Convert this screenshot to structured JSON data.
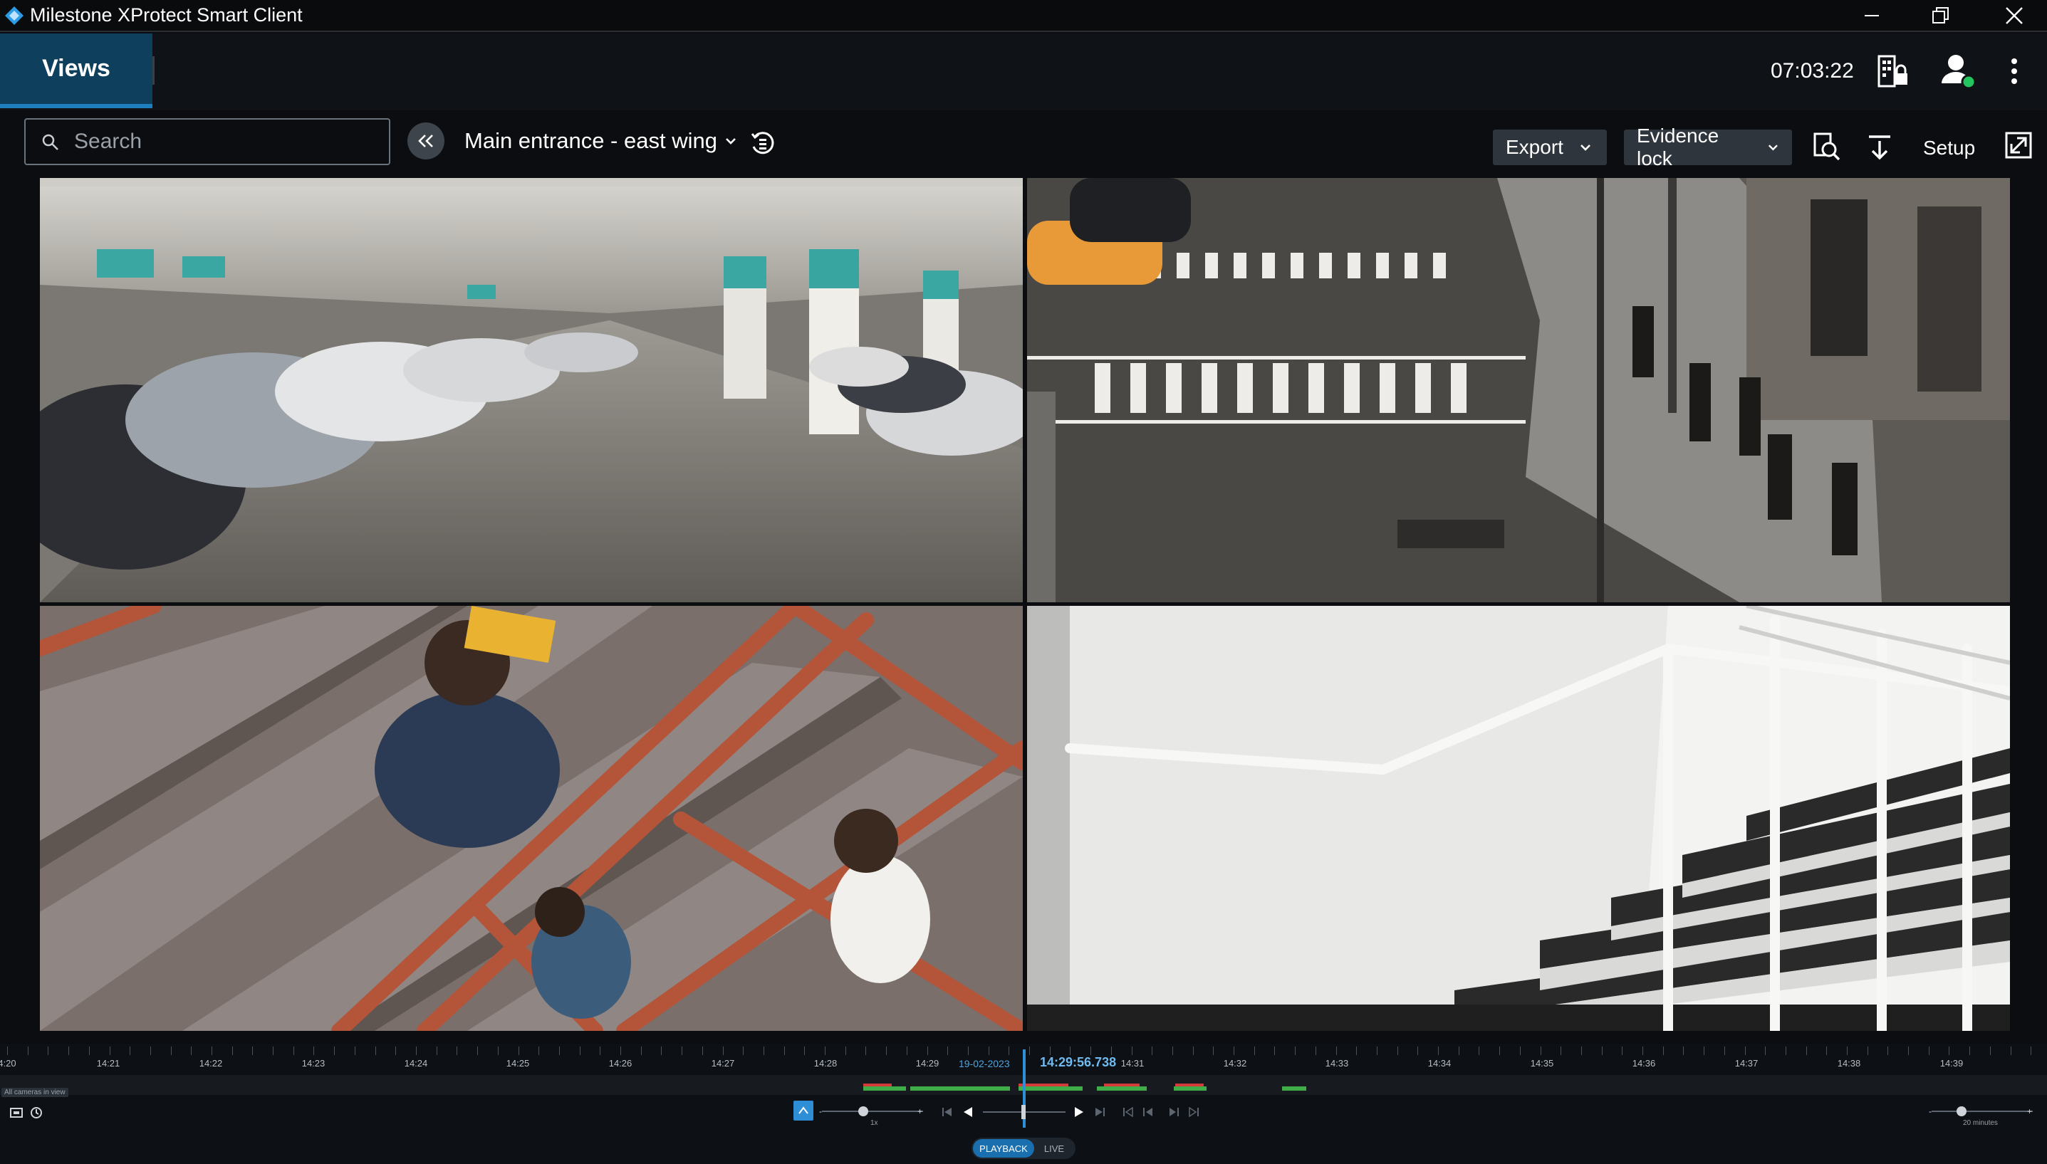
{
  "window": {
    "title": "Milestone XProtect Smart Client",
    "controls": [
      "minimize",
      "restore",
      "close"
    ]
  },
  "header": {
    "views_tab": "Views",
    "clock": "07:03:22",
    "icons": [
      "server-lock-icon",
      "user-online-icon",
      "more-vertical-icon"
    ],
    "user_status_color": "#22c55e"
  },
  "toolbar": {
    "search_placeholder": "Search",
    "view_name": "Main entrance - east wing",
    "export_label": "Export",
    "evidence_lock_label": "Evidence lock",
    "setup_label": "Setup"
  },
  "cameras": [
    {
      "scene": "parking-garage"
    },
    {
      "scene": "street-crosswalk"
    },
    {
      "scene": "stairwell-brown-railing"
    },
    {
      "scene": "white-stairwell"
    }
  ],
  "timeline": {
    "tick_labels": [
      "4:20",
      "14:21",
      "14:22",
      "14:23",
      "14:24",
      "14:25",
      "14:26",
      "14:27",
      "14:28",
      "14:29",
      "14:31",
      "14:32",
      "14:33",
      "14:34",
      "14:35",
      "14:36",
      "14:37",
      "14:38",
      "14:39"
    ],
    "date": "19-02-2023",
    "current_time": "14:29:56.738",
    "track_label": "All cameras in view",
    "speed_label": "1x",
    "zoom_label": "20 minutes",
    "mode": {
      "playback": "PLAYBACK",
      "live": "LIVE"
    },
    "accent_color": "#2f8fd6"
  }
}
